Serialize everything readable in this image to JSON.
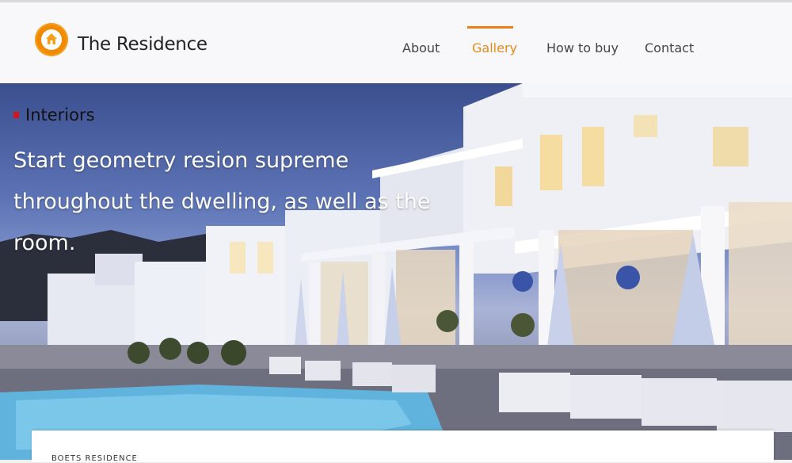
{
  "header": {
    "brand": "The Residence",
    "nav": [
      {
        "label": "About",
        "active": false
      },
      {
        "label": "Gallery",
        "active": true
      },
      {
        "label": "How to buy",
        "active": false
      },
      {
        "label": "Contact",
        "active": false
      }
    ]
  },
  "hero": {
    "label": "Interiors",
    "headline_line1": "Start geometry resion supreme",
    "headline_line2": "throughout the dwelling, as well as the room."
  },
  "card": {
    "heading": "BOETS RESIDENCE"
  },
  "colors": {
    "accent": "#ee7f16",
    "marker": "#d4161a"
  },
  "icons": {
    "logo": "house-icon"
  }
}
